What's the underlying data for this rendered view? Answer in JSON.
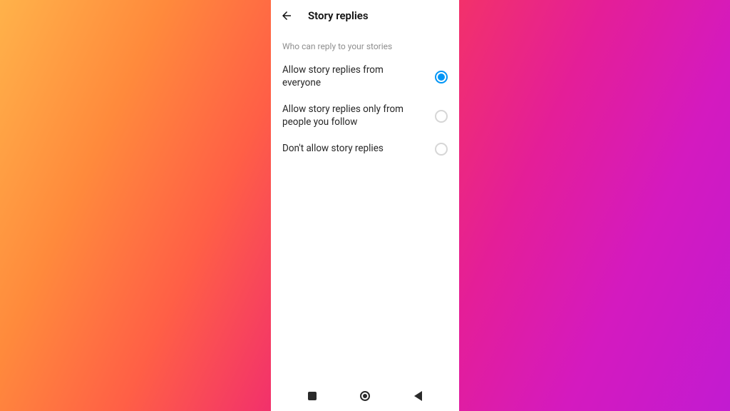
{
  "header": {
    "title": "Story replies"
  },
  "section": {
    "label": "Who can reply to your stories"
  },
  "options": [
    {
      "label": "Allow story replies from everyone",
      "selected": true
    },
    {
      "label": "Allow story replies only from people you follow",
      "selected": false
    },
    {
      "label": "Don't allow story replies",
      "selected": false
    }
  ],
  "colors": {
    "accent": "#0095f6"
  }
}
